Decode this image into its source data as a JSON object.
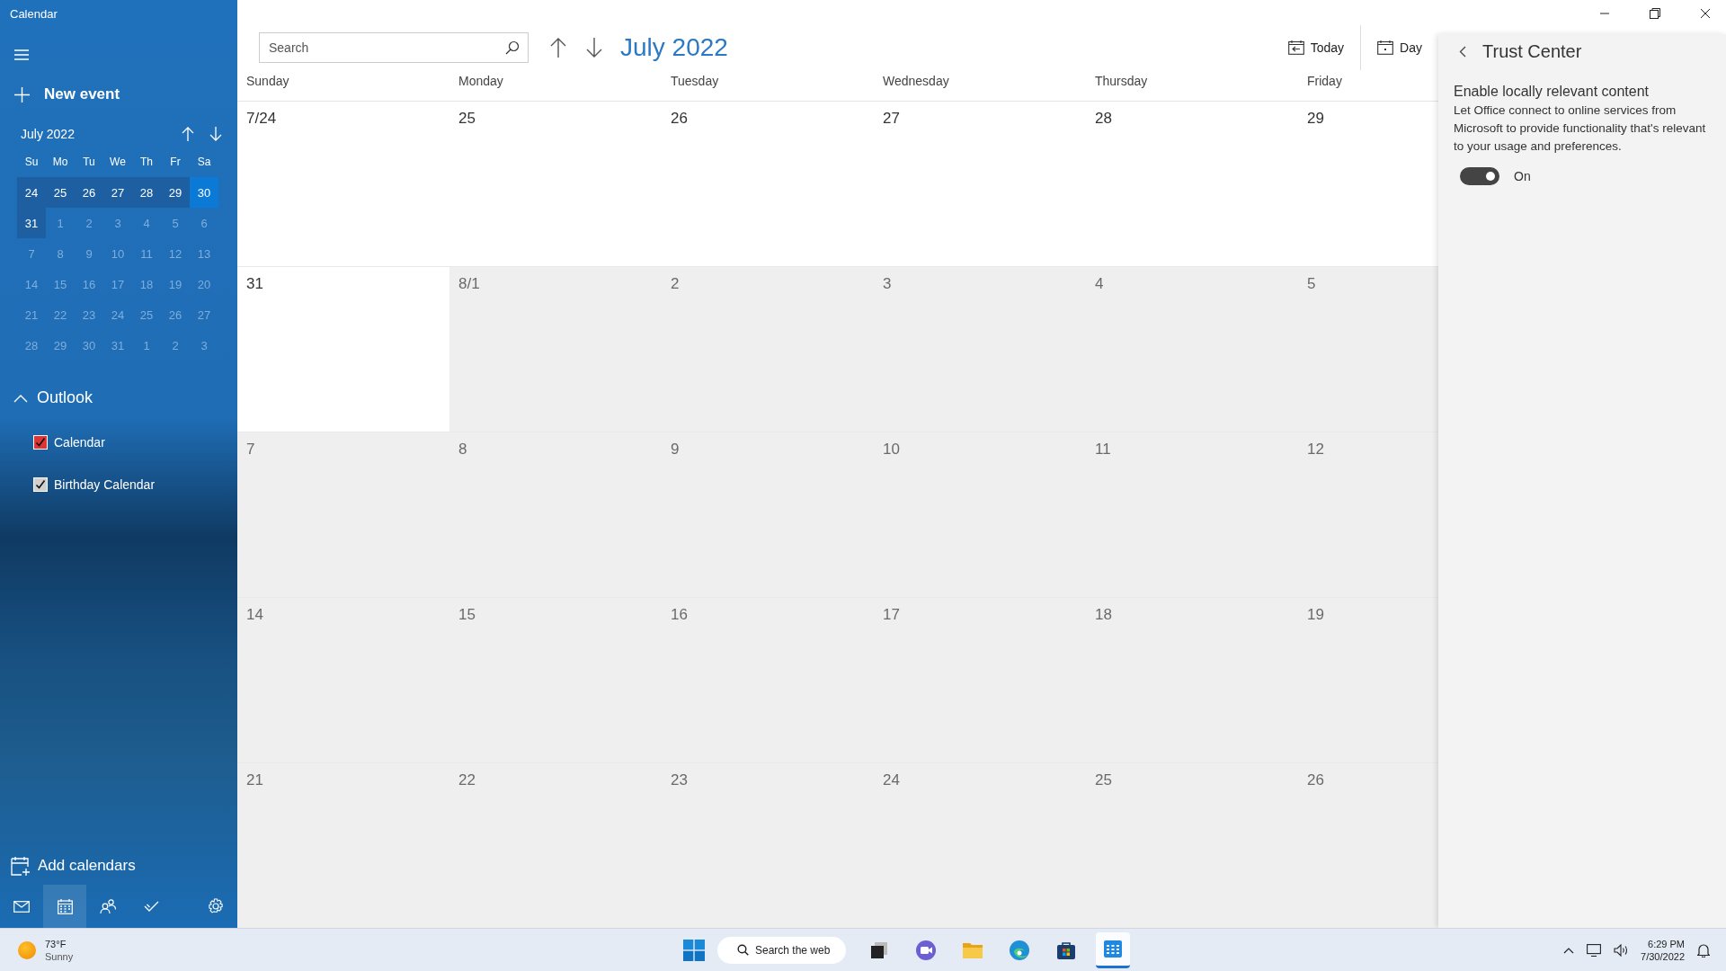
{
  "window": {
    "title": "Calendar"
  },
  "sidebar": {
    "new_event": "New event",
    "mini_calendar": {
      "title": "July 2022",
      "weekdays": [
        "Su",
        "Mo",
        "Tu",
        "We",
        "Th",
        "Fr",
        "Sa"
      ],
      "weeks": [
        [
          {
            "label": "24",
            "in_month": true,
            "highlighted": true,
            "selected": false
          },
          {
            "label": "25",
            "in_month": true,
            "highlighted": true,
            "selected": false
          },
          {
            "label": "26",
            "in_month": true,
            "highlighted": true,
            "selected": false
          },
          {
            "label": "27",
            "in_month": true,
            "highlighted": true,
            "selected": false
          },
          {
            "label": "28",
            "in_month": true,
            "highlighted": true,
            "selected": false
          },
          {
            "label": "29",
            "in_month": true,
            "highlighted": true,
            "selected": false
          },
          {
            "label": "30",
            "in_month": true,
            "highlighted": true,
            "selected": true
          }
        ],
        [
          {
            "label": "31",
            "in_month": true,
            "highlighted": true,
            "selected": false
          },
          {
            "label": "1",
            "in_month": false,
            "highlighted": false,
            "selected": false
          },
          {
            "label": "2",
            "in_month": false,
            "highlighted": false,
            "selected": false
          },
          {
            "label": "3",
            "in_month": false,
            "highlighted": false,
            "selected": false
          },
          {
            "label": "4",
            "in_month": false,
            "highlighted": false,
            "selected": false
          },
          {
            "label": "5",
            "in_month": false,
            "highlighted": false,
            "selected": false
          },
          {
            "label": "6",
            "in_month": false,
            "highlighted": false,
            "selected": false
          }
        ],
        [
          {
            "label": "7",
            "in_month": false,
            "highlighted": false,
            "selected": false
          },
          {
            "label": "8",
            "in_month": false,
            "highlighted": false,
            "selected": false
          },
          {
            "label": "9",
            "in_month": false,
            "highlighted": false,
            "selected": false
          },
          {
            "label": "10",
            "in_month": false,
            "highlighted": false,
            "selected": false
          },
          {
            "label": "11",
            "in_month": false,
            "highlighted": false,
            "selected": false
          },
          {
            "label": "12",
            "in_month": false,
            "highlighted": false,
            "selected": false
          },
          {
            "label": "13",
            "in_month": false,
            "highlighted": false,
            "selected": false
          }
        ],
        [
          {
            "label": "14",
            "in_month": false,
            "highlighted": false,
            "selected": false
          },
          {
            "label": "15",
            "in_month": false,
            "highlighted": false,
            "selected": false
          },
          {
            "label": "16",
            "in_month": false,
            "highlighted": false,
            "selected": false
          },
          {
            "label": "17",
            "in_month": false,
            "highlighted": false,
            "selected": false
          },
          {
            "label": "18",
            "in_month": false,
            "highlighted": false,
            "selected": false
          },
          {
            "label": "19",
            "in_month": false,
            "highlighted": false,
            "selected": false
          },
          {
            "label": "20",
            "in_month": false,
            "highlighted": false,
            "selected": false
          }
        ],
        [
          {
            "label": "21",
            "in_month": false,
            "highlighted": false,
            "selected": false
          },
          {
            "label": "22",
            "in_month": false,
            "highlighted": false,
            "selected": false
          },
          {
            "label": "23",
            "in_month": false,
            "highlighted": false,
            "selected": false
          },
          {
            "label": "24",
            "in_month": false,
            "highlighted": false,
            "selected": false
          },
          {
            "label": "25",
            "in_month": false,
            "highlighted": false,
            "selected": false
          },
          {
            "label": "26",
            "in_month": false,
            "highlighted": false,
            "selected": false
          },
          {
            "label": "27",
            "in_month": false,
            "highlighted": false,
            "selected": false
          }
        ],
        [
          {
            "label": "28",
            "in_month": false,
            "highlighted": false,
            "selected": false
          },
          {
            "label": "29",
            "in_month": false,
            "highlighted": false,
            "selected": false
          },
          {
            "label": "30",
            "in_month": false,
            "highlighted": false,
            "selected": false
          },
          {
            "label": "31",
            "in_month": false,
            "highlighted": false,
            "selected": false
          },
          {
            "label": "1",
            "in_month": false,
            "highlighted": false,
            "selected": false
          },
          {
            "label": "2",
            "in_month": false,
            "highlighted": false,
            "selected": false
          },
          {
            "label": "3",
            "in_month": false,
            "highlighted": false,
            "selected": false
          }
        ]
      ]
    },
    "group": {
      "label": "Outlook",
      "expanded": true,
      "calendars": [
        {
          "label": "Calendar",
          "checked": true,
          "color": "#e03434"
        },
        {
          "label": "Birthday Calendar",
          "checked": true,
          "color": "#d0d0d0"
        }
      ]
    },
    "add_calendars": "Add calendars",
    "nav": [
      {
        "kind": "mail",
        "selected": false
      },
      {
        "kind": "calendar",
        "selected": true
      },
      {
        "kind": "people",
        "selected": false
      },
      {
        "kind": "todo",
        "selected": false
      },
      {
        "kind": "settings",
        "selected": false
      }
    ]
  },
  "toolbar": {
    "search": {
      "placeholder": "Search"
    },
    "month": "July 2022",
    "today": "Today",
    "view": "Day"
  },
  "month_grid": {
    "weekdays": [
      "Sunday",
      "Monday",
      "Tuesday",
      "Wednesday",
      "Thursday",
      "Friday"
    ],
    "weeks": [
      [
        {
          "label": "7/24",
          "in_month": true
        },
        {
          "label": "25",
          "in_month": true
        },
        {
          "label": "26",
          "in_month": true
        },
        {
          "label": "27",
          "in_month": true
        },
        {
          "label": "28",
          "in_month": true
        },
        {
          "label": "29",
          "in_month": true
        }
      ],
      [
        {
          "label": "31",
          "in_month": true
        },
        {
          "label": "8/1",
          "in_month": false
        },
        {
          "label": "2",
          "in_month": false
        },
        {
          "label": "3",
          "in_month": false
        },
        {
          "label": "4",
          "in_month": false
        },
        {
          "label": "5",
          "in_month": false
        }
      ],
      [
        {
          "label": "7",
          "in_month": false
        },
        {
          "label": "8",
          "in_month": false
        },
        {
          "label": "9",
          "in_month": false
        },
        {
          "label": "10",
          "in_month": false
        },
        {
          "label": "11",
          "in_month": false
        },
        {
          "label": "12",
          "in_month": false
        }
      ],
      [
        {
          "label": "14",
          "in_month": false
        },
        {
          "label": "15",
          "in_month": false
        },
        {
          "label": "16",
          "in_month": false
        },
        {
          "label": "17",
          "in_month": false
        },
        {
          "label": "18",
          "in_month": false
        },
        {
          "label": "19",
          "in_month": false
        }
      ],
      [
        {
          "label": "21",
          "in_month": false
        },
        {
          "label": "22",
          "in_month": false
        },
        {
          "label": "23",
          "in_month": false
        },
        {
          "label": "24",
          "in_month": false
        },
        {
          "label": "25",
          "in_month": false
        },
        {
          "label": "26",
          "in_month": false
        }
      ]
    ]
  },
  "trust_center": {
    "title": "Trust Center",
    "heading": "Enable locally relevant content",
    "description": "Let Office connect to online services from Microsoft to provide functionality that's relevant to your usage and preferences.",
    "toggle": {
      "label": "On",
      "on": true
    }
  },
  "taskbar": {
    "weather": {
      "temperature": "73°F",
      "condition": "Sunny"
    },
    "search": "Search the web",
    "apps": [
      {
        "kind": "task-view",
        "active": false
      },
      {
        "kind": "chat",
        "active": false
      },
      {
        "kind": "folder",
        "active": false
      },
      {
        "kind": "browser",
        "active": false
      },
      {
        "kind": "store",
        "active": false
      },
      {
        "kind": "calendar",
        "active": true
      }
    ],
    "time": "6:29 PM",
    "date": "7/30/2022"
  }
}
